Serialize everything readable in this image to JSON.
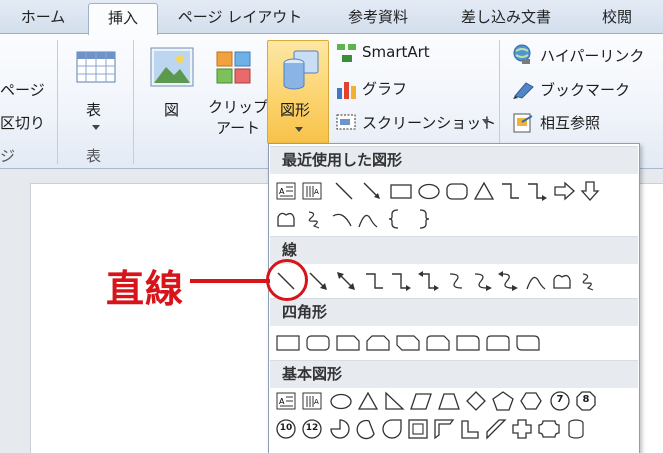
{
  "tabs": [
    {
      "label": "ホーム",
      "active": false
    },
    {
      "label": "挿入",
      "active": true
    },
    {
      "label": "ページ レイアウト",
      "active": false
    },
    {
      "label": "参考資料",
      "active": false
    },
    {
      "label": "差し込み文書",
      "active": false
    },
    {
      "label": "校閲",
      "active": false
    }
  ],
  "ribbon": {
    "pages_group": {
      "item1": "ページ",
      "item2": "区切り",
      "group_label": "ジ"
    },
    "table_group": {
      "button_label": "表",
      "group_label": "表"
    },
    "illustrations": {
      "picture_label": "図",
      "clipart_label_line1": "クリップ",
      "clipart_label_line2": "アート",
      "shapes_label": "図形",
      "smartart_label": "SmartArt",
      "chart_label": "グラフ",
      "screenshot_label": "スクリーンショット"
    },
    "links": {
      "hyperlink_label": "ハイパーリンク",
      "bookmark_label": "ブックマーク",
      "crossref_label": "相互参照"
    }
  },
  "dropdown": {
    "recent_header": "最近使用した図形",
    "lines_header": "線",
    "rect_header": "四角形",
    "basic_header": "基本図形",
    "basic_badges": [
      "7",
      "8",
      "10",
      "12"
    ]
  },
  "annotation": {
    "label": "直線"
  },
  "colors": {
    "annotation": "#d7141a",
    "pressed_button": "#fbd26a",
    "ribbon_bg": "#f1f5fb"
  }
}
